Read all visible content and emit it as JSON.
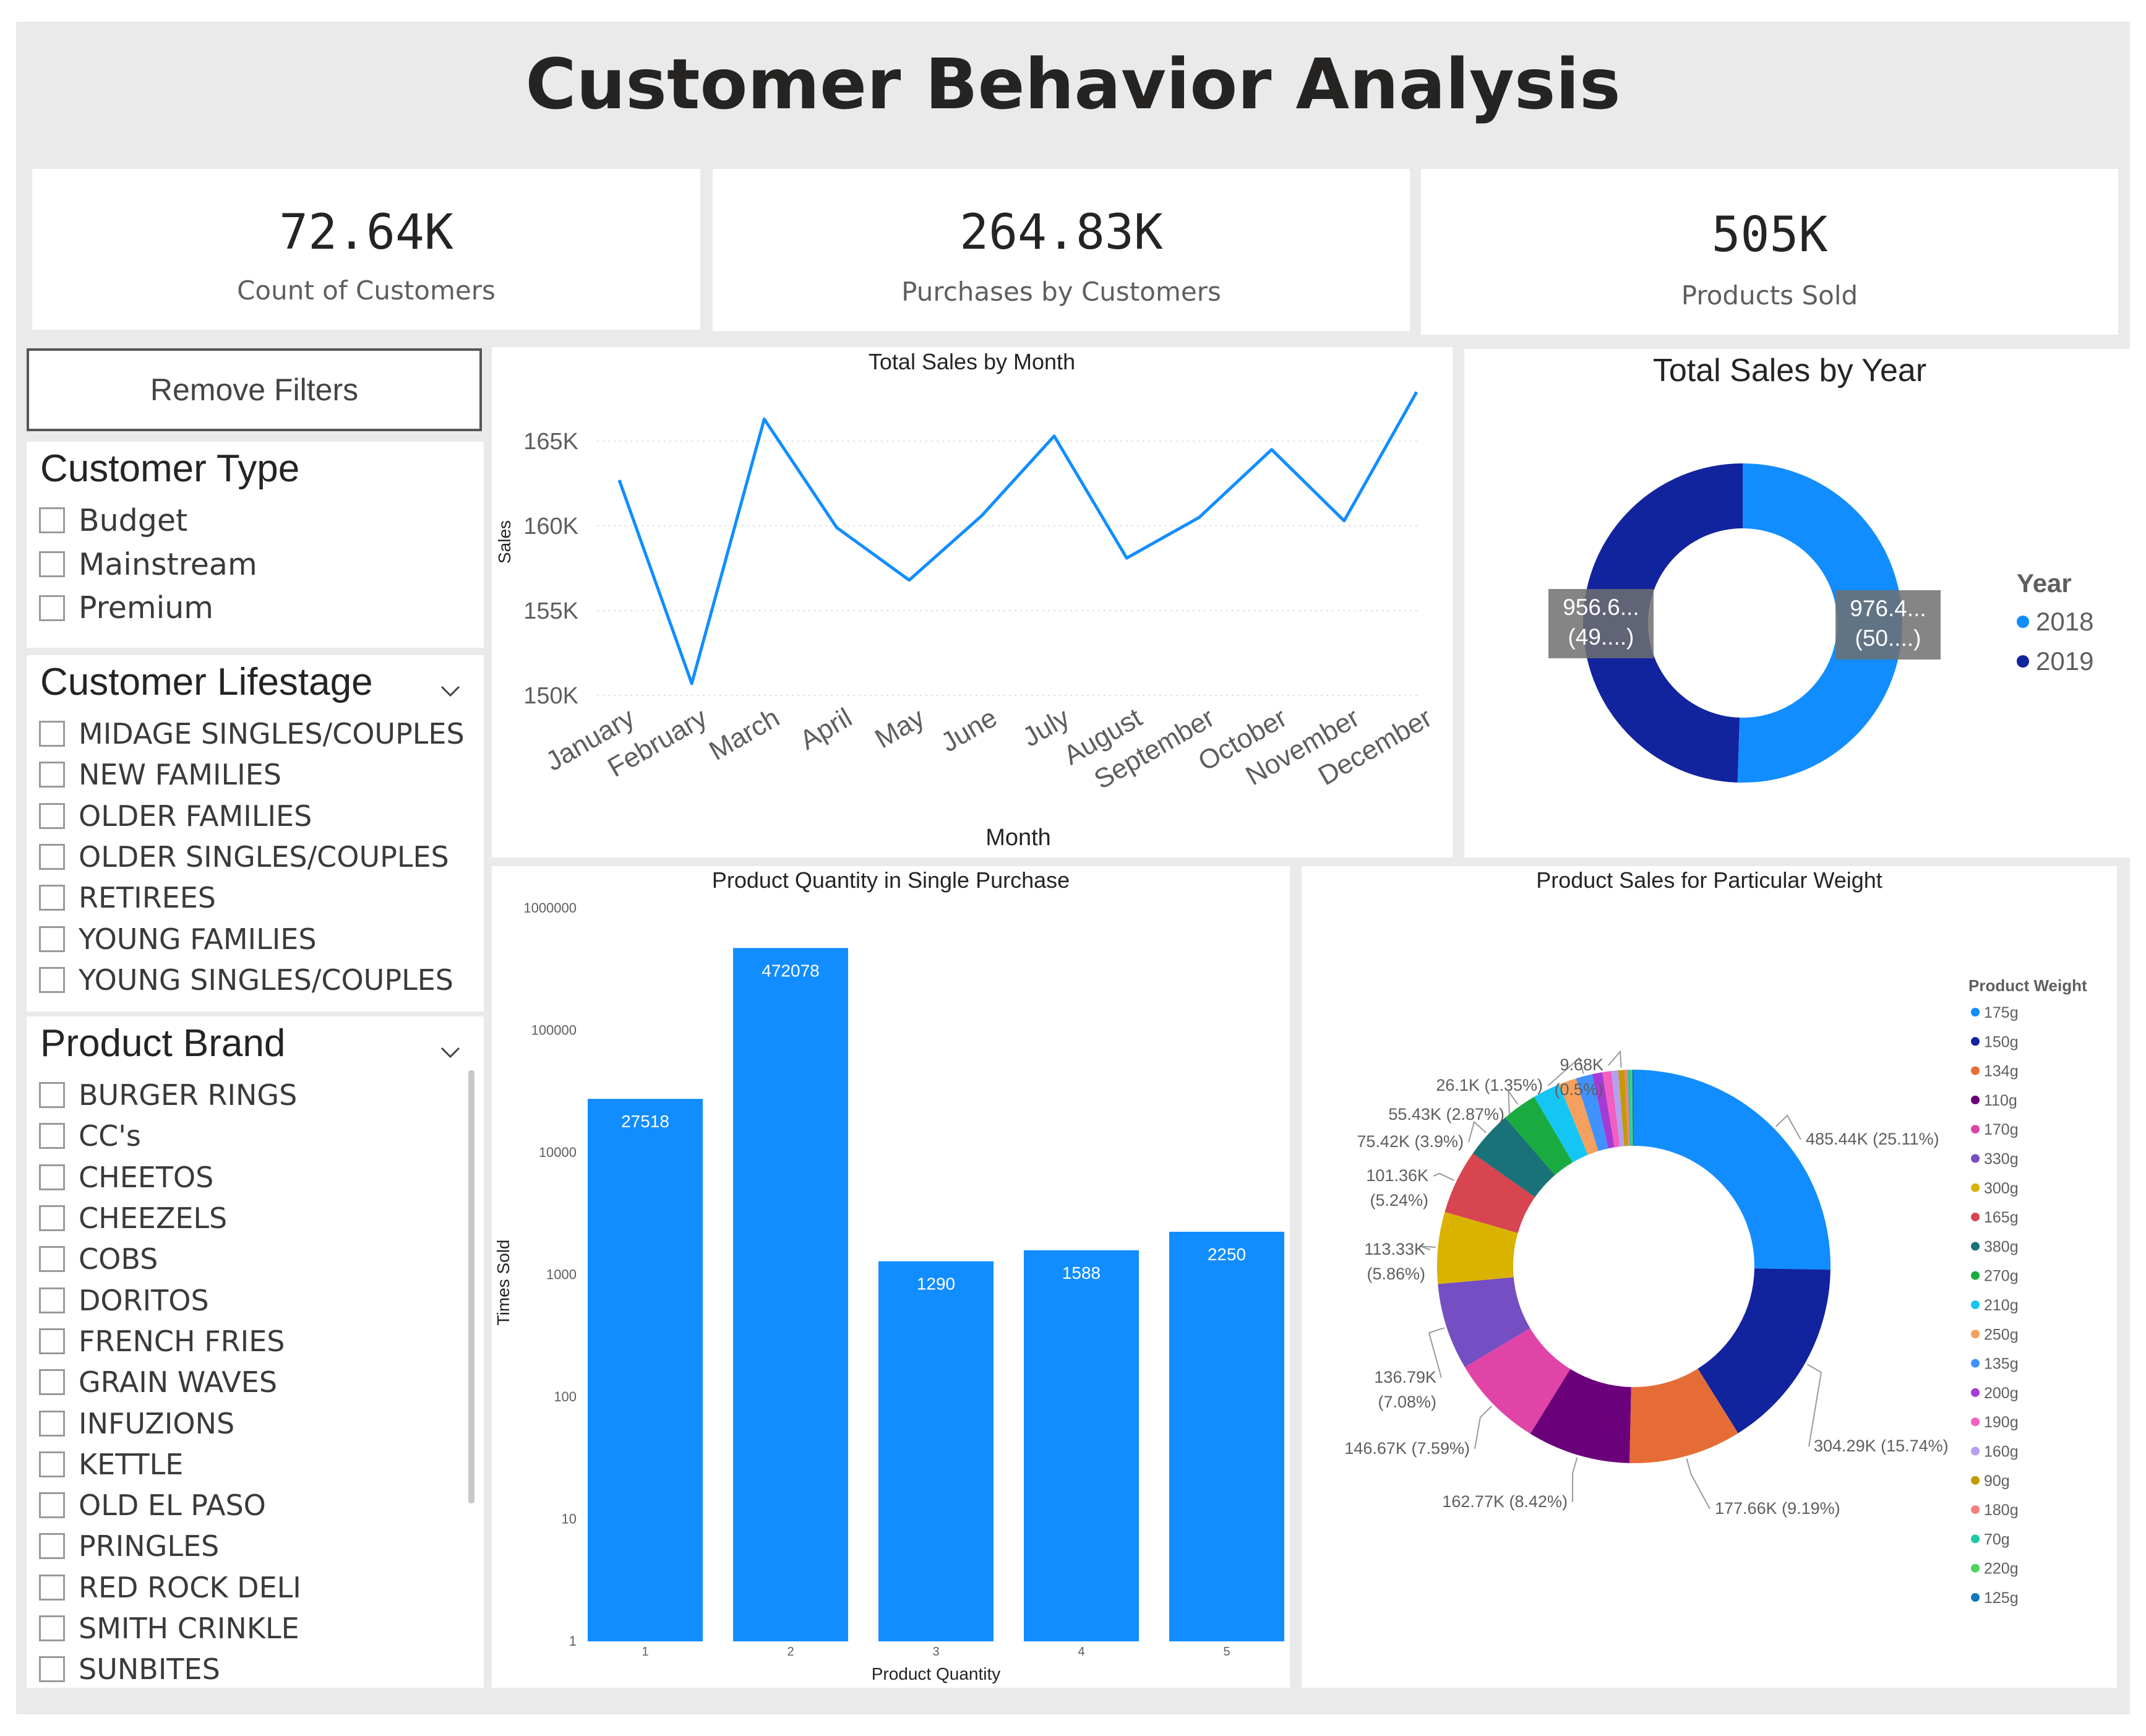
{
  "page": {
    "title": "Customer Behavior Analysis"
  },
  "kpis": [
    {
      "value": "72.64K",
      "label": "Count of Customers"
    },
    {
      "value": "264.83K",
      "label": "Purchases by Customers"
    },
    {
      "value": "505K",
      "label": "Products Sold"
    }
  ],
  "filters": {
    "remove_label": "Remove Filters",
    "customer_type": {
      "title": "Customer Type",
      "options": [
        "Budget",
        "Mainstream",
        "Premium"
      ]
    },
    "customer_lifestage": {
      "title": "Customer Lifestage",
      "options": [
        "MIDAGE SINGLES/COUPLES",
        "NEW FAMILIES",
        "OLDER FAMILIES",
        "OLDER SINGLES/COUPLES",
        "RETIREES",
        "YOUNG FAMILIES",
        "YOUNG SINGLES/COUPLES"
      ]
    },
    "product_brand": {
      "title": "Product Brand",
      "options": [
        "BURGER RINGS",
        "CC's",
        "CHEETOS",
        "CHEEZELS",
        "COBS",
        "DORITOS",
        "FRENCH FRIES",
        "GRAIN WAVES",
        "INFUZIONS",
        "KETTLE",
        "OLD EL PASO",
        "PRINGLES",
        "RED ROCK DELI",
        "SMITH CRINKLE",
        "SUNBITES"
      ]
    }
  },
  "icons": {
    "checkbox": "checkbox-icon",
    "chevron": "chevron-down-icon"
  },
  "colors": {
    "primary": "#118DFF",
    "dark_blue": "#12239E",
    "background": "#EAEAEA"
  },
  "chart_data": [
    {
      "type": "line",
      "title": "Total Sales by Month",
      "xlabel": "Month",
      "ylabel": "Sales",
      "categories": [
        "January",
        "February",
        "March",
        "April",
        "May",
        "June",
        "July",
        "August",
        "September",
        "October",
        "November",
        "December"
      ],
      "values": [
        162700,
        150700,
        166300,
        159900,
        156800,
        160600,
        165300,
        158100,
        160500,
        164500,
        160300,
        167900
      ],
      "ylim": [
        150000,
        170000
      ],
      "yticks": [
        150000,
        155000,
        160000,
        165000
      ],
      "ytick_labels": [
        "150K",
        "155K",
        "160K",
        "165K"
      ],
      "color": "#118DFF",
      "grid": true
    },
    {
      "type": "pie",
      "variant": "donut",
      "title": "Total Sales by Year",
      "legend_title": "Year",
      "legend_position": "right",
      "slices": [
        {
          "label": "2018",
          "value": 976400,
          "data_label": "976.4...",
          "pct_label": "(50....)",
          "color": "#118DFF"
        },
        {
          "label": "2019",
          "value": 956600,
          "data_label": "956.6...",
          "pct_label": "(49....)",
          "color": "#12239E"
        }
      ]
    },
    {
      "type": "bar",
      "title": "Product Quantity in Single Purchase",
      "xlabel": "Product Quantity",
      "ylabel": "Times Sold",
      "scale": "log",
      "categories": [
        "1",
        "2",
        "3",
        "4",
        "5"
      ],
      "values": [
        27518,
        472078,
        1290,
        1588,
        2250
      ],
      "ylim": [
        1,
        1000000
      ],
      "yticks": [
        1,
        10,
        100,
        1000,
        10000,
        100000,
        1000000
      ],
      "ytick_labels": [
        "1",
        "10",
        "100",
        "1000",
        "10000",
        "100000",
        "1000000"
      ],
      "color": "#118DFF"
    },
    {
      "type": "pie",
      "variant": "donut",
      "title": "Product Sales for Particular Weight",
      "legend_title": "Product Weight",
      "legend_position": "right",
      "slices": [
        {
          "label": "175g",
          "value": 485440,
          "data_label": "485.44K (25.11%)",
          "color": "#118DFF"
        },
        {
          "label": "150g",
          "value": 304290,
          "data_label": "304.29K (15.74%)",
          "color": "#12239E"
        },
        {
          "label": "134g",
          "value": 177660,
          "data_label": "177.66K (9.19%)",
          "color": "#E66C37"
        },
        {
          "label": "110g",
          "value": 162770,
          "data_label": "162.77K (8.42%)",
          "color": "#6B007B"
        },
        {
          "label": "170g",
          "value": 146670,
          "data_label": "146.67K (7.59%)",
          "color": "#E044A7"
        },
        {
          "label": "330g",
          "value": 136790,
          "data_label": "136.79K (7.08%)",
          "color": "#744EC2"
        },
        {
          "label": "300g",
          "value": 113330,
          "data_label": "113.33K (5.86%)",
          "color": "#D9B300"
        },
        {
          "label": "165g",
          "value": 101360,
          "data_label": "101.36K (5.24%)",
          "color": "#D64550"
        },
        {
          "label": "380g",
          "value": 75420,
          "data_label": "75.42K (3.9%)",
          "color": "#197278"
        },
        {
          "label": "270g",
          "value": 55430,
          "data_label": "55.43K (2.87%)",
          "color": "#1AAB40"
        },
        {
          "label": "210g",
          "value": 43000,
          "data_label": "",
          "color": "#15C6F4"
        },
        {
          "label": "250g",
          "value": 28000,
          "data_label": "",
          "color": "#F5A05E"
        },
        {
          "label": "135g",
          "value": 26100,
          "data_label": "26.1K (1.35%)",
          "color": "#4092FF"
        },
        {
          "label": "200g",
          "value": 16000,
          "data_label": "",
          "color": "#A43BD6"
        },
        {
          "label": "190g",
          "value": 14000,
          "data_label": "",
          "color": "#F25FC1"
        },
        {
          "label": "160g",
          "value": 11000,
          "data_label": "",
          "color": "#B4A0EF"
        },
        {
          "label": "90g",
          "value": 9680,
          "data_label": "9.68K (0.5%)",
          "color": "#C29B00"
        },
        {
          "label": "180g",
          "value": 5000,
          "data_label": "",
          "color": "#F2807F"
        },
        {
          "label": "70g",
          "value": 4000,
          "data_label": "",
          "color": "#1FC7A5"
        },
        {
          "label": "220g",
          "value": 3000,
          "data_label": "",
          "color": "#4CD45F"
        },
        {
          "label": "125g",
          "value": 2500,
          "data_label": "",
          "color": "#0F7ABA"
        }
      ]
    }
  ]
}
